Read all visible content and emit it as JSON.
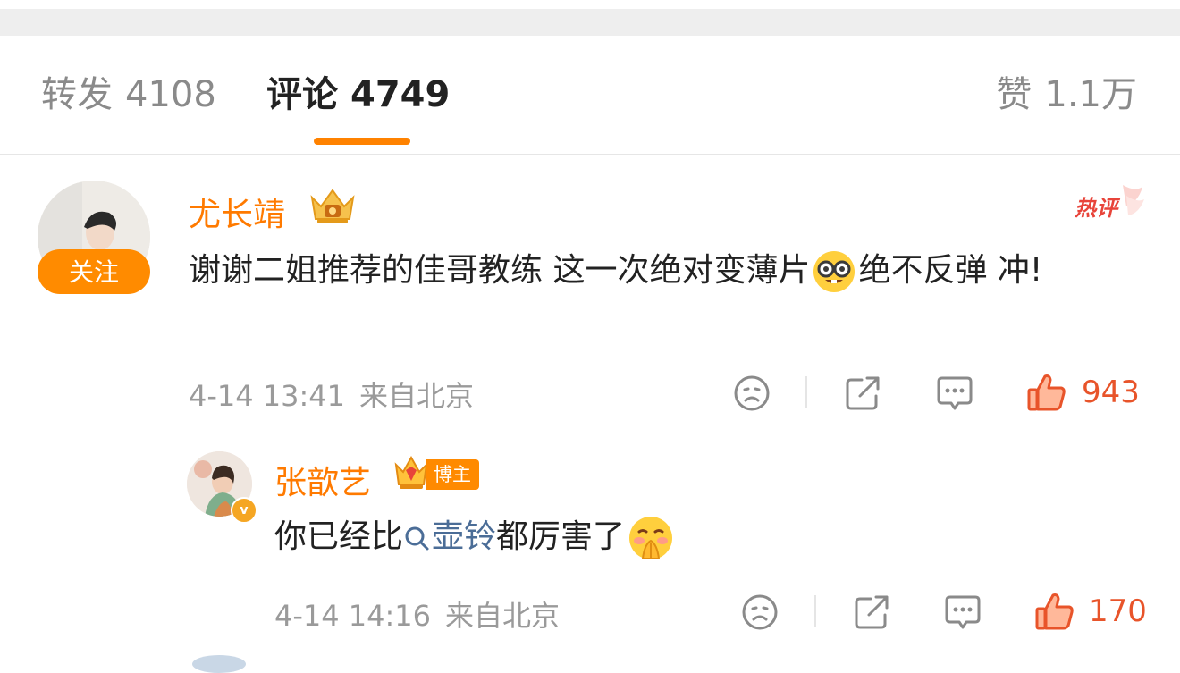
{
  "tabs": {
    "repost": {
      "label": "转发",
      "count": "4108"
    },
    "comment": {
      "label": "评论",
      "count": "4749"
    },
    "like": {
      "label": "赞",
      "count": "1.1万"
    }
  },
  "colors": {
    "accent": "#ff8200",
    "username": "#ff7a00",
    "like": "#e8542a",
    "link": "#4b6d97"
  },
  "comments": [
    {
      "username": "尤长靖",
      "follow_label": "关注",
      "hot_badge": "热评",
      "text_before": "谢谢二姐推荐的佳哥教练  这一次绝对变薄片",
      "emoji": "nerd-face-emoji",
      "text_after": "绝不反弹 冲!",
      "time": "4-14 13:41",
      "location": "来自北京",
      "likes": "943",
      "badge_icon": "crown-icon"
    }
  ],
  "reply": {
    "username": "张歆艺",
    "blogger_tag": "博主",
    "text_before": "你已经比",
    "topic": "壶铃",
    "text_after": "都厉害了",
    "emoji": "shush-face-emoji",
    "time": "4-14 14:16",
    "location": "来自北京",
    "likes": "170"
  }
}
